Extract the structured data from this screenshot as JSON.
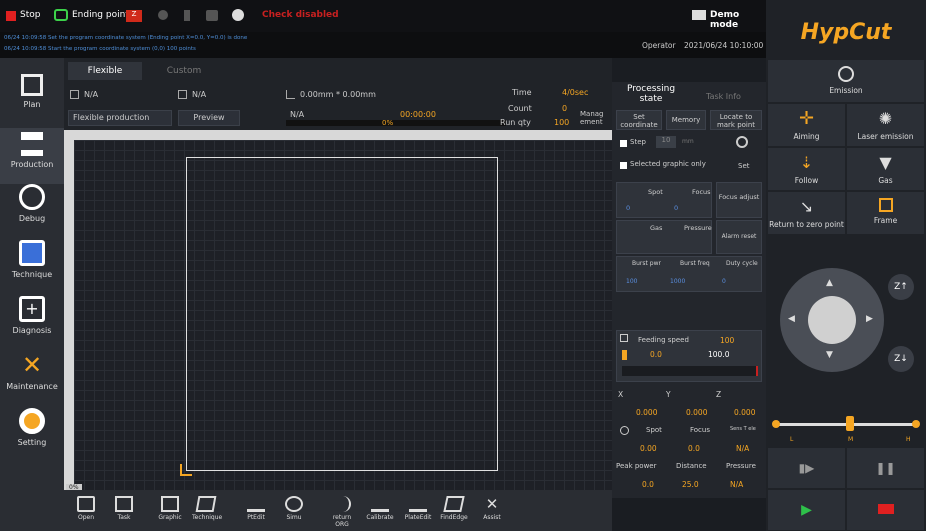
{
  "topbar": {
    "stop_label": "Stop",
    "ending_point_label": "Ending point",
    "check_label": "Check disabled",
    "demo_mode_label": "Demo mode",
    "operator_label": "Operator",
    "datetime": "2021/06/24 10:10:00",
    "log_line1": "06/24 10:09:58 Set the program coordinate system (Ending point X=0.0, Y=0.0) is done",
    "log_line2": "06/24 10:09:58 Start the program coordinate system (0,0) 100 points"
  },
  "brand": {
    "logo": "HypCut"
  },
  "sidebar": {
    "items": [
      {
        "label": "Plan"
      },
      {
        "label": "Production"
      },
      {
        "label": "Debug"
      },
      {
        "label": "Technique"
      },
      {
        "label": "Diagnosis"
      },
      {
        "label": "Maintenance"
      },
      {
        "label": "Setting"
      }
    ]
  },
  "tabs": [
    {
      "label": "Flexible"
    },
    {
      "label": "Custom"
    }
  ],
  "info": {
    "na1": "N/A",
    "na2": "N/A",
    "size": "0.00mm * 0.00mm",
    "mode_dropdown": "Flexible production",
    "preview_label": "Preview",
    "na3": "N/A",
    "time_val": "00:00:00",
    "percent": "0%",
    "time_label": "Time",
    "time_value": "4/0sec",
    "count_label": "Count",
    "count_value": "0",
    "run_qty_label": "Run qty",
    "run_qty_value": "100",
    "manage_label": "Manag ement"
  },
  "proc_tabs": {
    "processing": "Processing state",
    "task_info": "Task Info"
  },
  "proc": {
    "set_coord": "Set coordinate",
    "memory": "Memory",
    "locate": "Locate to mark point",
    "step_label": "Step",
    "step_value": "10",
    "step_unit": "mm",
    "selected_graphic": "Selected graphic only",
    "set_label": "Set",
    "spot_label": "Spot",
    "focus_label": "Focus",
    "focus_adjust": "Focus adjust",
    "spot_val": "0",
    "focus_val": "0",
    "gas_label": "Gas",
    "pressure_label": "Pressure",
    "alarm_label": "Alarm reset",
    "burst_pwr": "Burst pwr",
    "burst_freq": "Burst freq",
    "duty_cycle": "Duty cycle",
    "bp_val": "100",
    "bf_val": "1000",
    "dc_val": "0",
    "feeding_speed_label": "Feeding speed",
    "feeding_speed_value": "100",
    "feed_a": "0.0",
    "feed_b": "100.0",
    "x_label": "X",
    "y_label": "Y",
    "z_label": "Z",
    "x_val": "0.000",
    "y_val": "0.000",
    "z_val": "0.000",
    "spot2_label": "Spot",
    "focus2_label": "Focus",
    "sens_label": "Sens T ele",
    "spot2_val": "0.00",
    "focus2_val": "0.0",
    "sens_val": "N/A",
    "peak_power_label": "Peak power",
    "distance_label": "Distance",
    "pressure2_label": "Pressure",
    "peak_val": "0.0",
    "dist_val": "25.0",
    "pres_val": "N/A"
  },
  "right": {
    "emission": "Emission",
    "aiming": "Aiming",
    "laser_emission": "Laser emission",
    "follow": "Follow",
    "gas": "Gas",
    "return_zero": "Return to zero point",
    "frame": "Frame",
    "z_up": "Z↑",
    "z_down": "Z↓",
    "speed_l": "L",
    "speed_m": "M",
    "speed_h": "H"
  },
  "bottom": {
    "items": [
      {
        "label": "Open"
      },
      {
        "label": "Task"
      },
      {
        "label": "Graphic"
      },
      {
        "label": "Technique"
      },
      {
        "label": "PtEdit"
      },
      {
        "label": "Simu"
      },
      {
        "label": "return ORG"
      },
      {
        "label": "Calibrate"
      },
      {
        "label": "PlateEdit"
      },
      {
        "label": "FindEdge"
      },
      {
        "label": "Assist"
      }
    ]
  },
  "canvas_label": "0%"
}
